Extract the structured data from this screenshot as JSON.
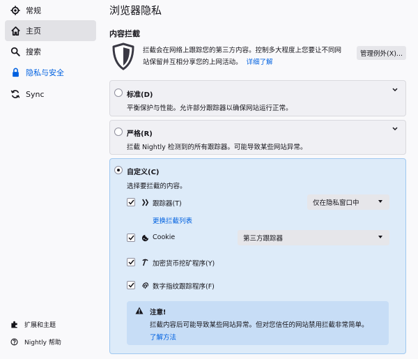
{
  "sidebar": {
    "items": [
      {
        "label": "常规",
        "icon": "gear-icon"
      },
      {
        "label": "主页",
        "icon": "home-icon"
      },
      {
        "label": "搜索",
        "icon": "search-icon"
      },
      {
        "label": "隐私与安全",
        "icon": "lock-icon"
      },
      {
        "label": "Sync",
        "icon": "sync-icon"
      }
    ],
    "bottom": [
      {
        "label": "扩展和主题",
        "icon": "puzzle-icon"
      },
      {
        "label": "Nightly 帮助",
        "icon": "help-icon"
      }
    ]
  },
  "page": {
    "title": "浏览器隐私",
    "section_title": "内容拦截",
    "description": "拦截会在网络上跟踪您的第三方内容。控制多大程度上您要让不同网站保留并互相分享您的上网活动。",
    "learn_more": "详细了解",
    "manage_exceptions": "管理例外(X)..."
  },
  "options": {
    "standard": {
      "title": "标准(D)",
      "description": "平衡保护与性能。允许部分跟踪器以确保网站运行正常。"
    },
    "strict": {
      "title": "严格(R)",
      "description": "拦截 Nightly 检测到的所有跟踪器。可能导致某些网站异常。"
    },
    "custom": {
      "title": "自定义(C)",
      "description": "选择要拦截的内容。",
      "trackers_label": "跟踪器(T)",
      "trackers_select": "仅在隐私窗口中",
      "change_list": "更换拦截列表",
      "cookie_label": "Cookie",
      "cookie_select": "第三方跟踪器",
      "cryptominers_label": "加密货币挖矿程序(Y)",
      "fingerprinters_label": "数字指纹跟踪程序(F)"
    }
  },
  "warning": {
    "title": "注意!",
    "text": "拦截内容后可能导致某些网站异常。但对您信任的网站禁用拦截非常简单。",
    "link": "了解方法"
  },
  "colors": {
    "accent": "#0061e0",
    "custom_bg": "#ddebf9",
    "warning_bg": "#c7ddf6"
  }
}
